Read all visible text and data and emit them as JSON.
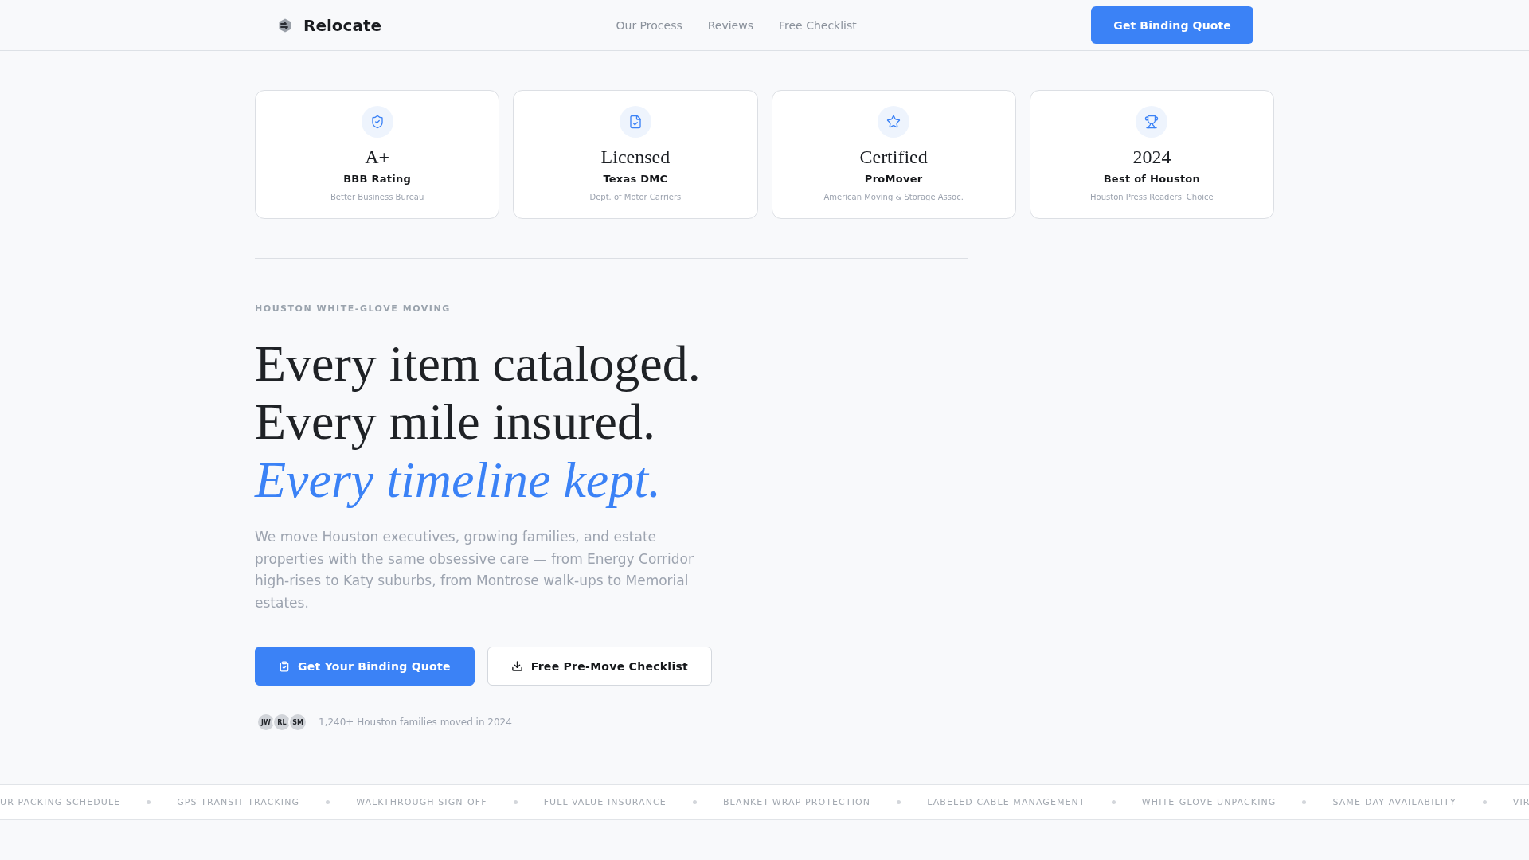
{
  "nav": {
    "brand": "Relocate",
    "links": [
      "Our Process",
      "Reviews",
      "Free Checklist"
    ],
    "cta": "Get Binding Quote"
  },
  "credentials": [
    {
      "value": "A+",
      "title": "BBB Rating",
      "source": "Better Business Bureau"
    },
    {
      "value": "Licensed",
      "title": "Texas DMC",
      "source": "Dept. of Motor Carriers"
    },
    {
      "value": "Certified",
      "title": "ProMover",
      "source": "American Moving & Storage Assoc."
    },
    {
      "value": "2024",
      "title": "Best of Houston",
      "source": "Houston Press Readers' Choice"
    }
  ],
  "hero": {
    "eyebrow": "HOUSTON WHITE-GLOVE MOVING",
    "headline": [
      {
        "text": "Every item cataloged.",
        "accent": false
      },
      {
        "text": "Every mile insured.",
        "accent": false
      },
      {
        "text": "Every timeline kept.",
        "accent": true
      }
    ],
    "intro": "We move Houston executives, growing families, and estate properties with the same obsessive care — from Energy Corridor high-rises to Katy suburbs, from Montrose walk-ups to Memorial estates.",
    "buttons": [
      {
        "label": "Get Your Binding Quote",
        "kind": "primary"
      },
      {
        "label": "Free Pre-Move Checklist",
        "kind": "secondary"
      }
    ],
    "avatars": [
      "JW",
      "RL",
      "SM"
    ],
    "social_proof": "1,240+ Houston families moved in 2024"
  },
  "ticker": [
    "UR PACKING SCHEDULE",
    "GPS TRANSIT TRACKING",
    "WALKTHROUGH SIGN-OFF",
    "FULL-VALUE INSURANCE",
    "BLANKET-WRAP PROTECTION",
    "LABELED CABLE MANAGEMENT",
    "WHITE-GLOVE UNPACKING",
    "SAME-DAY AVAILABILITY",
    "VIR"
  ]
}
